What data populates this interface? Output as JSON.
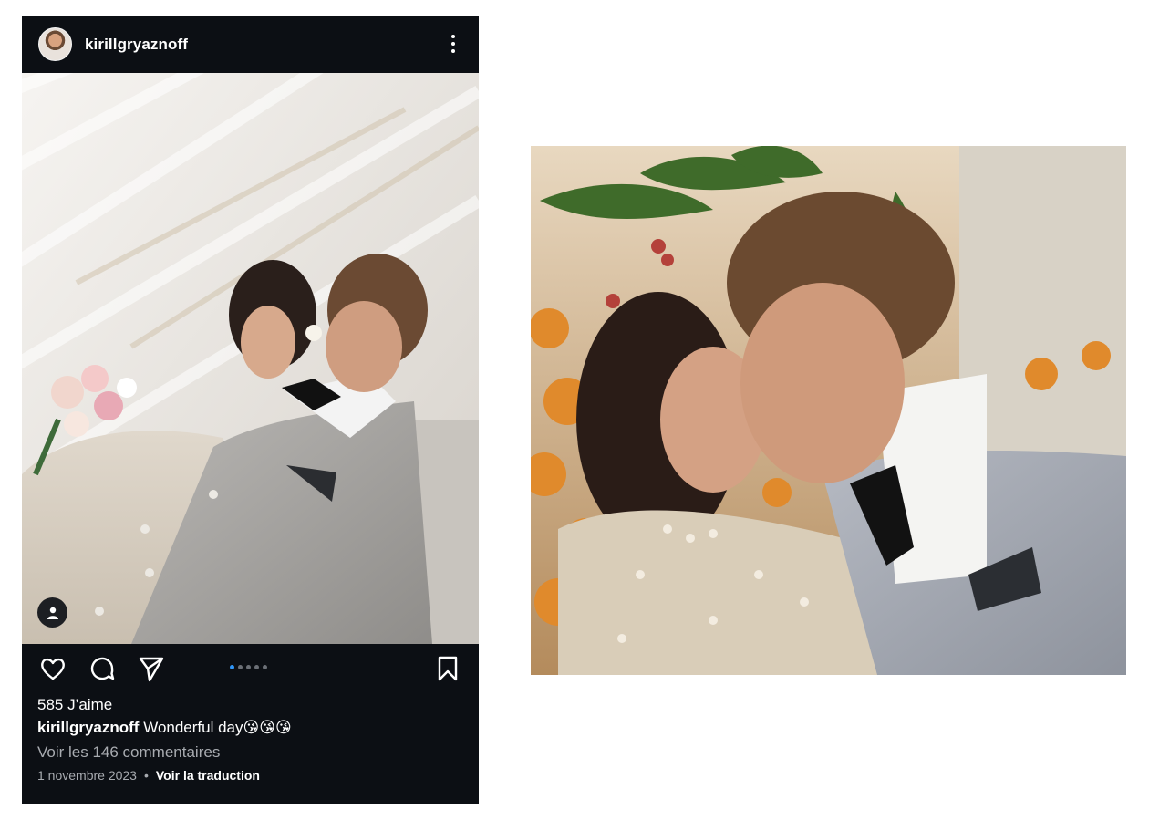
{
  "post": {
    "username": "kirillgryaznoff",
    "likes": "585 J’aime",
    "caption_user": "kirillgryaznoff",
    "caption_text": "Wonderful day😘😘😘",
    "comments_link": "Voir les 146 commentaires",
    "date": "1 novembre 2023",
    "separator": "•",
    "translate_link": "Voir la traduction",
    "carousel": {
      "count": 5,
      "active_index": 1
    }
  },
  "icons": {
    "more": "more-vertical-icon",
    "like": "heart-icon",
    "comment": "comment-icon",
    "share": "send-icon",
    "save": "bookmark-icon",
    "user_tag": "user-tag-icon"
  },
  "colors": {
    "post_background": "#0c0f14",
    "carousel_active": "#2f95f7",
    "muted_text": "#a8abb0"
  }
}
